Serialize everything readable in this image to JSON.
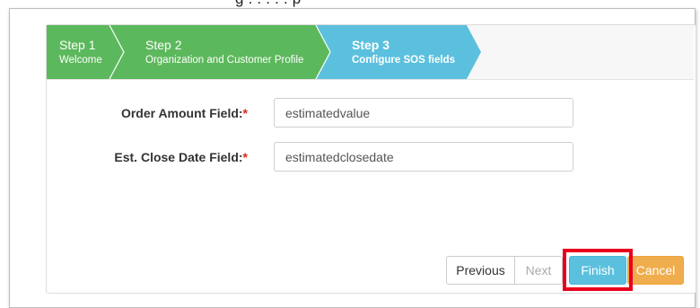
{
  "header": {
    "partial_text": "g . . . . . p"
  },
  "wizard": {
    "steps": [
      {
        "title": "Step 1",
        "subtitle": "Welcome",
        "state": "completed"
      },
      {
        "title": "Step 2",
        "subtitle": "Organization and Customer Profile",
        "state": "completed"
      },
      {
        "title": "Step 3",
        "subtitle": "Configure SOS fields",
        "state": "active"
      }
    ]
  },
  "form": {
    "order_amount": {
      "label": "Order Amount Field:",
      "required": "*",
      "value": "estimatedvalue"
    },
    "close_date": {
      "label": "Est. Close Date Field:",
      "required": "*",
      "value": "estimatedclosedate"
    }
  },
  "buttons": {
    "previous": "Previous",
    "next": "Next",
    "finish": "Finish",
    "cancel": "Cancel"
  },
  "colors": {
    "step_completed": "#5cb85c",
    "step_active": "#5bc0de",
    "finish": "#5bc0de",
    "cancel": "#f0ad4e",
    "highlight": "#e8001c"
  }
}
